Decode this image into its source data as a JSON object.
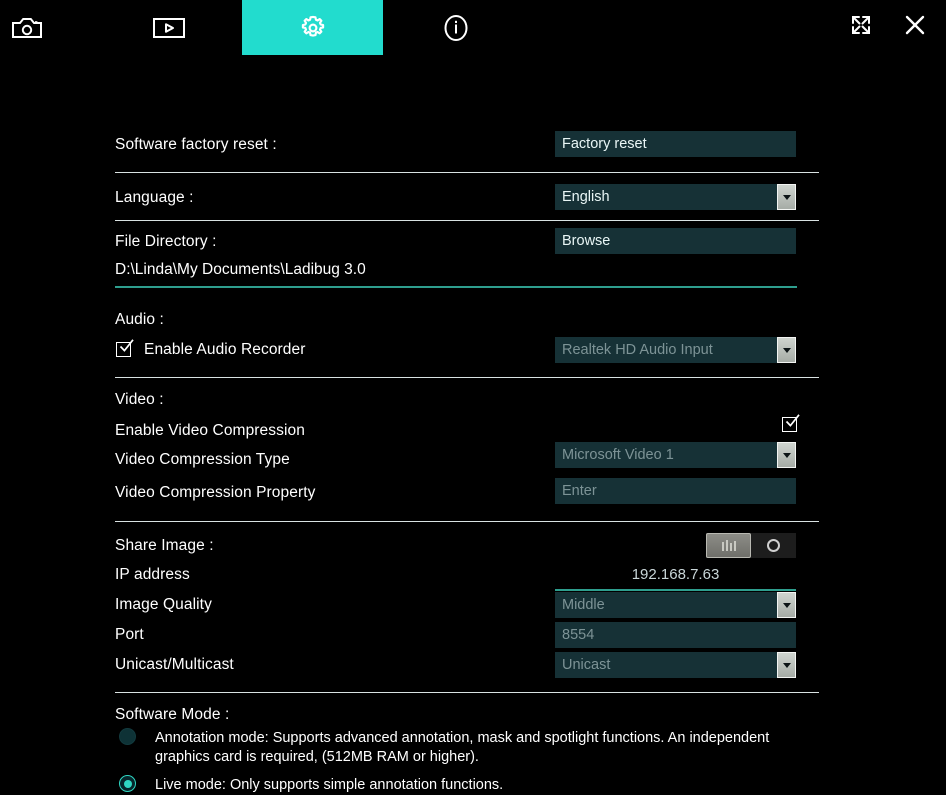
{
  "toolbar": {
    "tabs": [
      {
        "id": "capture",
        "icon": "camera-icon",
        "label": "Capture",
        "active": false
      },
      {
        "id": "record",
        "icon": "video-play-icon",
        "label": "Record",
        "active": false
      },
      {
        "id": "settings",
        "icon": "gear-icon",
        "label": "Settings",
        "active": true
      },
      {
        "id": "info",
        "icon": "info-icon",
        "label": "Info",
        "active": false
      }
    ],
    "window_buttons": [
      {
        "id": "fullscreen",
        "icon": "fullscreen-icon",
        "label": "Fullscreen"
      },
      {
        "id": "close",
        "icon": "close-icon",
        "label": "Close"
      }
    ],
    "active_accent": "#22dcce"
  },
  "settings": {
    "factory_reset": {
      "label": "Software factory reset :",
      "button": "Factory reset"
    },
    "language": {
      "label": "Language :",
      "value": "English"
    },
    "file_directory": {
      "label": "File Directory :",
      "button": "Browse",
      "path": "D:\\Linda\\My Documents\\Ladibug 3.0"
    },
    "audio": {
      "heading": "Audio :",
      "enable_label": "Enable Audio Recorder",
      "enable_checked": true,
      "device": "Realtek HD Audio Input"
    },
    "video": {
      "heading": "Video :",
      "compression_label": "Enable Video Compression",
      "compression_checked": true,
      "type_label": "Video Compression Type",
      "type_value": "Microsoft Video 1",
      "property_label": "Video Compression Property",
      "property_placeholder": "Enter"
    },
    "share_image": {
      "heading": "Share Image :",
      "toggle_state": "off",
      "ip_label": "IP address",
      "ip_value": "192.168.7.63",
      "quality_label": "Image Quality",
      "quality_value": "Middle",
      "port_label": "Port",
      "port_value": "8554",
      "cast_label": "Unicast/Multicast",
      "cast_value": "Unicast"
    },
    "software_mode": {
      "heading": "Software Mode :",
      "options": [
        {
          "id": "annotation",
          "text": "Annotation mode: Supports advanced annotation, mask and spotlight functions. An independent graphics card is required, (512MB RAM or higher).",
          "selected": false
        },
        {
          "id": "live",
          "text": "Live mode: Only supports simple annotation functions.",
          "selected": true
        }
      ]
    }
  }
}
